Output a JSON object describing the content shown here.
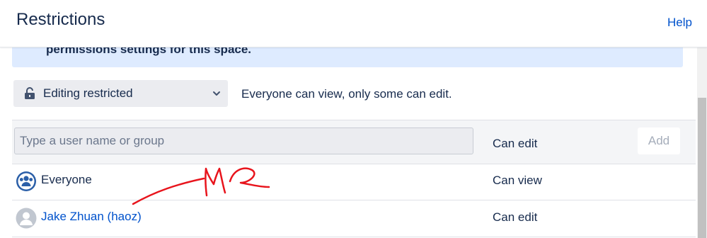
{
  "dialog": {
    "title": "Restrictions",
    "help_label": "Help"
  },
  "banner": {
    "text": "permissions settings for this space."
  },
  "restriction": {
    "selected": "Editing restricted",
    "description": "Everyone can view, only some can edit."
  },
  "add_user": {
    "placeholder": "Type a user name or group",
    "permission": "Can edit",
    "add_label": "Add"
  },
  "rows": [
    {
      "name": "Everyone",
      "permission": "Can view",
      "avatar": "group-icon"
    },
    {
      "name": "Jake Zhuan (haoz)",
      "permission": "Can edit",
      "avatar": "user-avatar-icon"
    }
  ],
  "colors": {
    "accent": "#0052cc",
    "banner": "#deebff",
    "annotation": "#e8141c",
    "group_icon": "#2b5fa8"
  }
}
